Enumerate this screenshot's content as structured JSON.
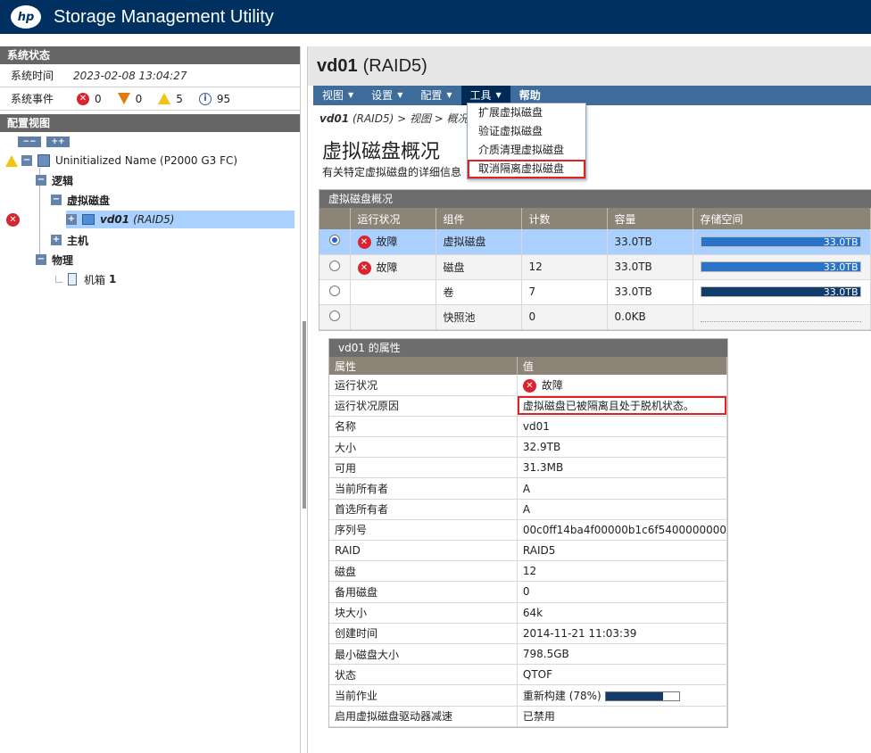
{
  "header": {
    "logo_text": "hp",
    "title": "Storage Management Utility"
  },
  "system_status": {
    "heading": "系统状态",
    "time_label": "系统时间",
    "time_value": "2023-02-08 13:04:27",
    "events_label": "系统事件",
    "events": [
      {
        "icon": "error-icon",
        "count": "0"
      },
      {
        "icon": "critical-icon",
        "count": "0"
      },
      {
        "icon": "warning-icon",
        "count": "5"
      },
      {
        "icon": "info-icon",
        "count": "95"
      }
    ]
  },
  "config_view": {
    "heading": "配置视图",
    "collapse_label": "−−",
    "expand_label": "++",
    "root_label": "Uninitialized Name (P2000 G3 FC)",
    "logical_label": "逻辑",
    "vdisks_label": "虚拟磁盘",
    "vd_name": "vd01",
    "vd_raid": "(RAID5)",
    "host_label": "主机",
    "physical_label": "物理",
    "enclosure_label": "机箱",
    "enclosure_num": "1"
  },
  "main": {
    "title_name": "vd01",
    "title_raid": "(RAID5)",
    "menus": [
      "视图",
      "设置",
      "配置",
      "工具",
      "帮助"
    ],
    "breadcrumb_name": "vd01",
    "breadcrumb_rest": "(RAID5) > 视图 > 概况",
    "page_title": "虚拟磁盘概况",
    "page_subtitle": "有关特定虚拟磁盘的详细信息",
    "tools_menu": [
      "扩展虚拟磁盘",
      "验证虚拟磁盘",
      "介质清理虚拟磁盘",
      "取消隔离虚拟磁盘"
    ]
  },
  "overview": {
    "heading": "虚拟磁盘概况",
    "columns": [
      "运行状况",
      "组件",
      "计数",
      "容量",
      "存储空间"
    ],
    "rows": [
      {
        "selected": true,
        "health": "故障",
        "component": "虚拟磁盘",
        "count": "",
        "capacity": "33.0TB",
        "bar_label": "33.0TB",
        "fill_fraction": 1.0
      },
      {
        "selected": false,
        "health": "故障",
        "component": "磁盘",
        "count": "12",
        "capacity": "33.0TB",
        "bar_label": "33.0TB",
        "fill_fraction": 1.0
      },
      {
        "selected": false,
        "health": "",
        "component": "卷",
        "count": "7",
        "capacity": "33.0TB",
        "bar_label": "33.0TB",
        "fill_fraction": 1.0
      },
      {
        "selected": false,
        "health": "",
        "component": "快照池",
        "count": "0",
        "capacity": "0.0KB",
        "bar_label": "",
        "fill_fraction": 0.0
      }
    ]
  },
  "properties": {
    "heading": "vd01 的属性",
    "col_attr": "属性",
    "col_val": "值",
    "rows": [
      [
        "运行状况",
        "故障"
      ],
      [
        "运行状况原因",
        "虚拟磁盘已被隔离且处于脱机状态。"
      ],
      [
        "名称",
        "vd01"
      ],
      [
        "大小",
        "32.9TB"
      ],
      [
        "可用",
        "31.3MB"
      ],
      [
        "当前所有者",
        "A"
      ],
      [
        "首选所有者",
        "A"
      ],
      [
        "序列号",
        "00c0ff14ba4f00000b1c6f5400000000"
      ],
      [
        "RAID",
        "RAID5"
      ],
      [
        "磁盘",
        "12"
      ],
      [
        "备用磁盘",
        "0"
      ],
      [
        "块大小",
        "64k"
      ],
      [
        "创建时间",
        "2014-11-21 11:03:39"
      ],
      [
        "最小磁盘大小",
        "798.5GB"
      ],
      [
        "状态",
        "QTOF"
      ],
      [
        "当前作业",
        "重新构建 (78%)"
      ],
      [
        "启用虚拟磁盘驱动器减速",
        "已禁用"
      ]
    ],
    "rebuild_progress": 0.78
  }
}
